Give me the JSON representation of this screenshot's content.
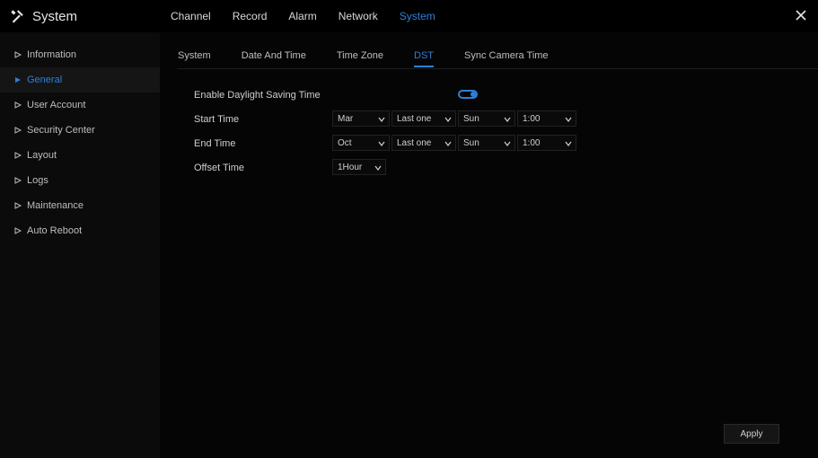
{
  "app": {
    "title": "System"
  },
  "topnav": {
    "tabs": [
      {
        "label": "Channel"
      },
      {
        "label": "Record"
      },
      {
        "label": "Alarm"
      },
      {
        "label": "Network"
      },
      {
        "label": "System"
      }
    ]
  },
  "sidebar": {
    "items": [
      {
        "label": "Information"
      },
      {
        "label": "General"
      },
      {
        "label": "User Account"
      },
      {
        "label": "Security Center"
      },
      {
        "label": "Layout"
      },
      {
        "label": "Logs"
      },
      {
        "label": "Maintenance"
      },
      {
        "label": "Auto Reboot"
      }
    ]
  },
  "subtabs": {
    "items": [
      {
        "label": "System"
      },
      {
        "label": "Date And Time"
      },
      {
        "label": "Time Zone"
      },
      {
        "label": "DST"
      },
      {
        "label": "Sync Camera Time"
      }
    ]
  },
  "form": {
    "enable_dst_label": "Enable Daylight Saving Time",
    "enable_dst_on": true,
    "start_time_label": "Start Time",
    "end_time_label": "End Time",
    "offset_time_label": "Offset Time",
    "start": {
      "month": "Mar",
      "week": "Last one",
      "day": "Sun",
      "hour": "1:00"
    },
    "end": {
      "month": "Oct",
      "week": "Last one",
      "day": "Sun",
      "hour": "1:00"
    },
    "offset": "1Hour"
  },
  "actions": {
    "apply_label": "Apply"
  },
  "colors": {
    "accent": "#2f7fd8",
    "background": "#040404",
    "text": "#cfcfcf"
  },
  "icons": {
    "brand": "tools-icon",
    "close": "close-icon",
    "sidebar_arrow": "play-arrow-icon",
    "dropdown": "chevron-down-icon"
  }
}
